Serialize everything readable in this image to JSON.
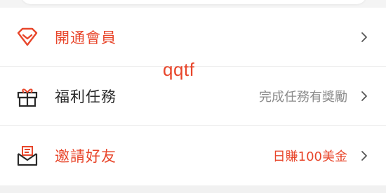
{
  "menu": {
    "items": [
      {
        "label": "開通會員",
        "value": "",
        "icon": "diamond-icon",
        "label_color": "#e8462b"
      },
      {
        "label": "福利任務",
        "value": "完成任務有獎勵",
        "icon": "gift-icon",
        "label_color": "#2a2a2a"
      },
      {
        "label": "邀請好友",
        "value": "日賺100美金",
        "icon": "envelope-icon",
        "label_color": "#e8462b"
      }
    ]
  },
  "watermark_text": "qqtf",
  "colors": {
    "accent": "#e8462b",
    "text": "#2a2a2a",
    "secondary": "#8a8a8a",
    "background": "#f4f4f4"
  }
}
